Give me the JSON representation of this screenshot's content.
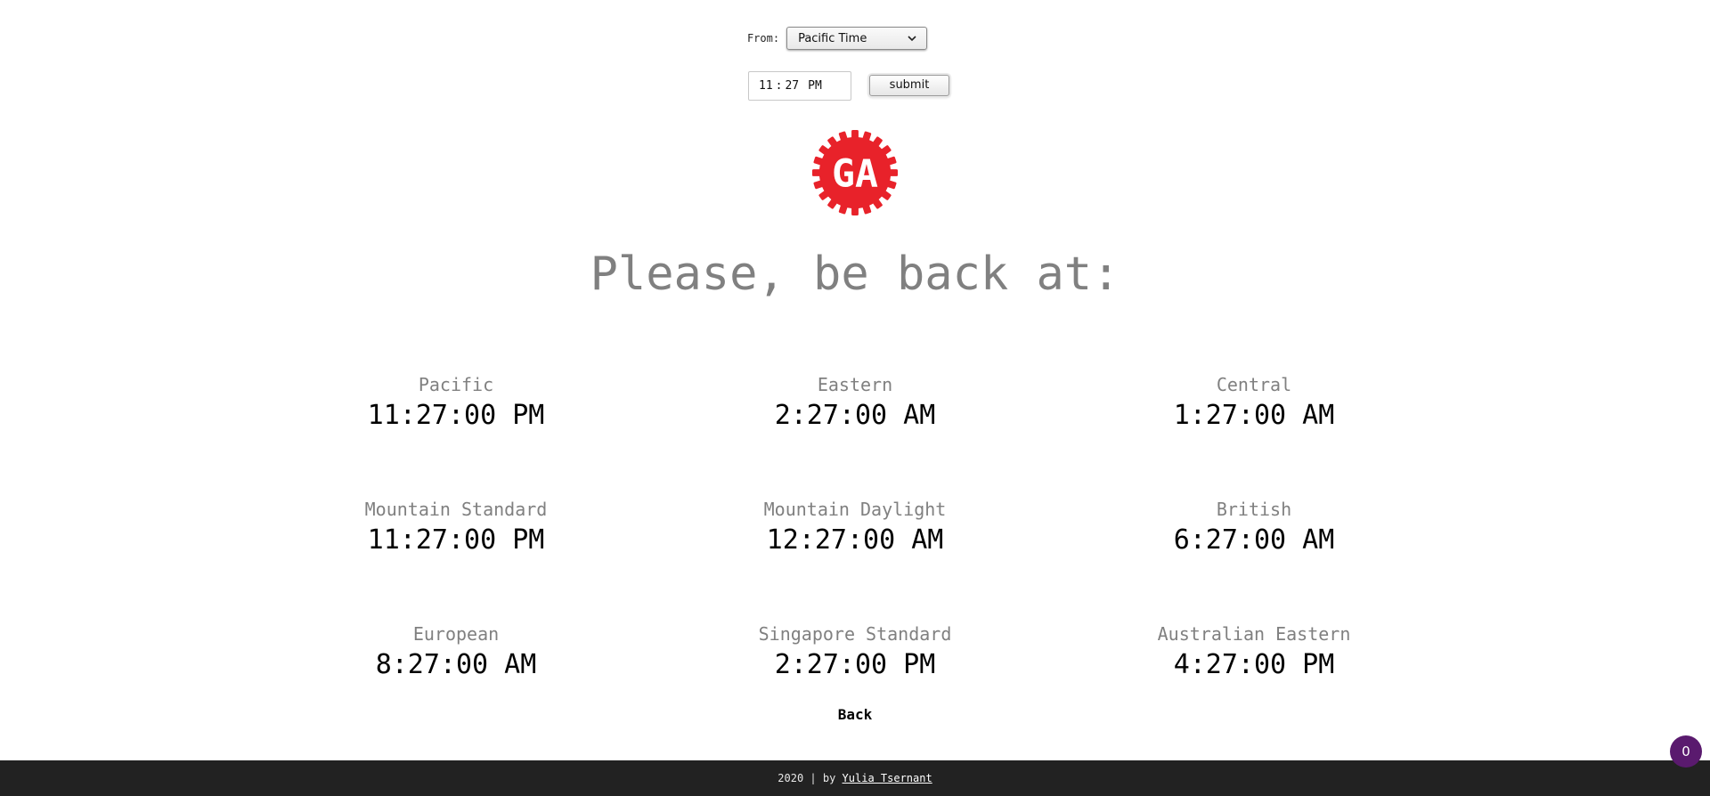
{
  "form": {
    "from_label": "From:",
    "from_selected": "Pacific Time",
    "time_hours": "11",
    "time_minutes": "27",
    "time_ampm": "PM",
    "submit_label": "submit"
  },
  "logo": {
    "text": "GA",
    "color": "#e8222a"
  },
  "headline": "Please, be back at:",
  "zones": [
    {
      "name": "Pacific",
      "time": "11:27:00 PM"
    },
    {
      "name": "Eastern",
      "time": "2:27:00 AM"
    },
    {
      "name": "Central",
      "time": "1:27:00 AM"
    },
    {
      "name": "Mountain Standard",
      "time": "11:27:00 PM"
    },
    {
      "name": "Mountain Daylight",
      "time": "12:27:00 AM"
    },
    {
      "name": "British",
      "time": "6:27:00 AM"
    },
    {
      "name": "European",
      "time": "8:27:00 AM"
    },
    {
      "name": "Singapore Standard",
      "time": "2:27:00 PM"
    },
    {
      "name": "Australian Eastern",
      "time": "4:27:00 PM"
    }
  ],
  "back_label": "Back",
  "footer": {
    "prefix": "2020 | by ",
    "author": "Yulia Tsernant"
  },
  "badge": {
    "count": "0",
    "color": "#5a1a6e"
  }
}
